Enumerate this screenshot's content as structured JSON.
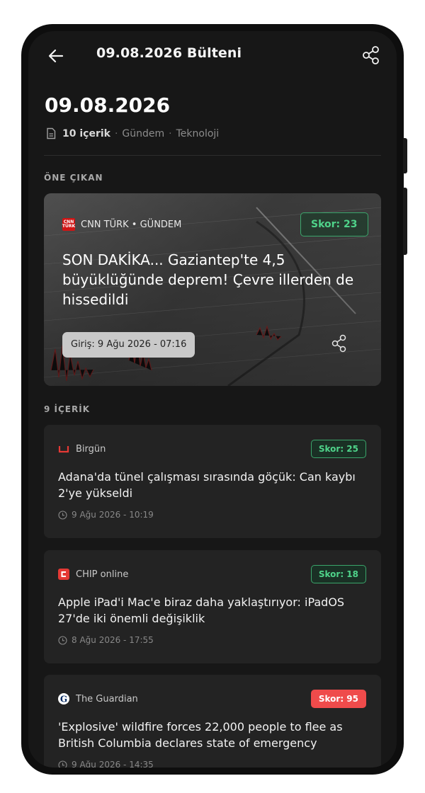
{
  "topbar": {
    "title": "09.08.2026 Bülteni"
  },
  "header": {
    "date": "09.08.2026",
    "count_label": "10 içerik",
    "categories": [
      "Gündem",
      "Teknoloji"
    ],
    "separator": "·"
  },
  "featured_section": {
    "label": "ÖNE ÇIKAN"
  },
  "featured": {
    "source": "CNN TÜRK • GÜNDEM",
    "logo_text": "CNN TÜRK",
    "score": "Skor: 23",
    "title": "SON DAKİKA... Gaziantep'te 4,5 büyüklüğünde deprem! Çevre illerden de hissedildi",
    "time": "Giriş: 9 Ağu 2026 - 07:16"
  },
  "list_section": {
    "label": "9 İÇERİK"
  },
  "items": [
    {
      "source": "Birgün",
      "score": "Skor: 25",
      "score_level": "low",
      "title": "Adana'da tünel çalışması sırasında göçük: Can kaybı 2'ye yükseldi",
      "time": "9 Ağu 2026 - 10:19"
    },
    {
      "source": "CHIP online",
      "score": "Skor: 18",
      "score_level": "low",
      "title": "Apple iPad'i Mac'e biraz daha yaklaştırıyor: iPadOS 27'de iki önemli değişiklik",
      "time": "8 Ağu 2026 - 17:55"
    },
    {
      "source": "The Guardian",
      "score": "Skor: 95",
      "score_level": "high",
      "title": "'Explosive' wildfire forces 22,000 people to flee as British Columbia declares state of emergency",
      "time": "9 Ağu 2026 - 14:35"
    }
  ],
  "colors": {
    "score_low": "#4fd38a",
    "score_high": "#ef4b4b",
    "background": "#171717",
    "card": "#232323"
  }
}
